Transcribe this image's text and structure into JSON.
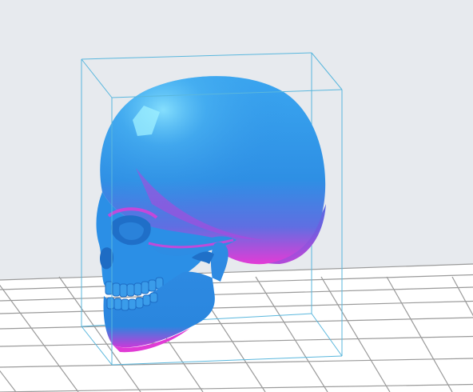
{
  "viewport": {
    "background_color": "#e7eaee",
    "floor_color": "#ffffff",
    "grid_line_color": "#9a9a9a",
    "bounding_box_color": "#5ab7dd"
  },
  "model": {
    "object": "skull-icon",
    "primary_color": "#2f9ae8",
    "overhang_highlight_color": "#e23bd8",
    "selected": true
  }
}
